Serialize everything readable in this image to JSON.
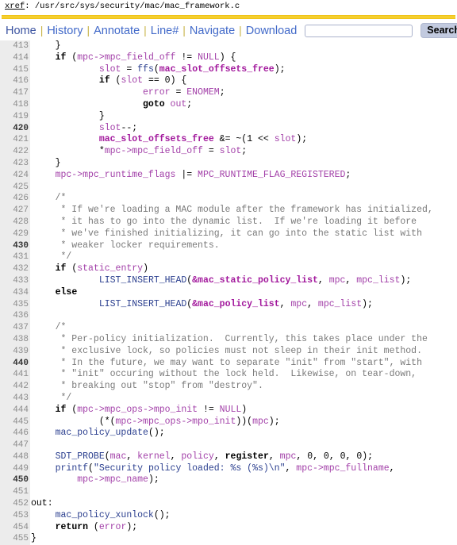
{
  "header": {
    "xref_label": "xref",
    "xref_colon": ": ",
    "file_path": "/usr/src/sys/security/mac/mac_framework.c"
  },
  "menubar": {
    "items": [
      {
        "label": "Home",
        "name": "nav-home"
      },
      {
        "label": "History",
        "name": "nav-history"
      },
      {
        "label": "Annotate",
        "name": "nav-annotate"
      },
      {
        "label": "Line#",
        "name": "nav-linenum"
      },
      {
        "label": "Navigate",
        "name": "nav-navigate"
      },
      {
        "label": "Download",
        "name": "nav-download"
      }
    ],
    "separator": "|",
    "search_value": "",
    "search_placeholder": "",
    "search_button_label": "Search",
    "checkbox_label": ""
  },
  "colors": {
    "rule_gold": "#f5cf2f",
    "link_blue": "#4169c9",
    "gutter_bg": "#ececec",
    "symbol_magenta": "#a23fa8",
    "function_navy": "#2b3f8f",
    "comment_gray": "#7a7a7a",
    "button_bg": "#c2cadf"
  },
  "code": {
    "first_line": 413,
    "lines": [
      {
        "n": "413",
        "segments": [
          {
            "t": "p",
            "x": "    }"
          }
        ]
      },
      {
        "n": "414",
        "segments": [
          {
            "t": "p",
            "x": "    "
          },
          {
            "t": "k",
            "x": "if"
          },
          {
            "t": "p",
            "x": " ("
          },
          {
            "t": "v",
            "x": "mpc->mpc_field_off"
          },
          {
            "t": "p",
            "x": " != "
          },
          {
            "t": "v",
            "x": "NULL"
          },
          {
            "t": "p",
            "x": ") {"
          }
        ]
      },
      {
        "n": "415",
        "segments": [
          {
            "t": "p",
            "x": "            "
          },
          {
            "t": "v",
            "x": "slot"
          },
          {
            "t": "p",
            "x": " = "
          },
          {
            "t": "f",
            "x": "ffs"
          },
          {
            "t": "p",
            "x": "("
          },
          {
            "t": "vb",
            "x": "mac_slot_offsets_free"
          },
          {
            "t": "p",
            "x": ");"
          }
        ]
      },
      {
        "n": "416",
        "segments": [
          {
            "t": "p",
            "x": "            "
          },
          {
            "t": "k",
            "x": "if"
          },
          {
            "t": "p",
            "x": " ("
          },
          {
            "t": "v",
            "x": "slot"
          },
          {
            "t": "p",
            "x": " == "
          },
          {
            "t": "n",
            "x": "0"
          },
          {
            "t": "p",
            "x": ") {"
          }
        ]
      },
      {
        "n": "417",
        "segments": [
          {
            "t": "p",
            "x": "                    "
          },
          {
            "t": "v",
            "x": "error"
          },
          {
            "t": "p",
            "x": " = "
          },
          {
            "t": "v",
            "x": "ENOMEM"
          },
          {
            "t": "p",
            "x": ";"
          }
        ]
      },
      {
        "n": "418",
        "segments": [
          {
            "t": "p",
            "x": "                    "
          },
          {
            "t": "k",
            "x": "goto"
          },
          {
            "t": "p",
            "x": " "
          },
          {
            "t": "v",
            "x": "out"
          },
          {
            "t": "p",
            "x": ";"
          }
        ]
      },
      {
        "n": "419",
        "segments": [
          {
            "t": "p",
            "x": "            }"
          }
        ]
      },
      {
        "n": "420",
        "segments": [
          {
            "t": "p",
            "x": "            "
          },
          {
            "t": "v",
            "x": "slot"
          },
          {
            "t": "p",
            "x": "--;"
          }
        ]
      },
      {
        "n": "421",
        "segments": [
          {
            "t": "p",
            "x": "            "
          },
          {
            "t": "vb",
            "x": "mac_slot_offsets_free"
          },
          {
            "t": "p",
            "x": " &= ~("
          },
          {
            "t": "n",
            "x": "1"
          },
          {
            "t": "p",
            "x": " << "
          },
          {
            "t": "v",
            "x": "slot"
          },
          {
            "t": "p",
            "x": ");"
          }
        ]
      },
      {
        "n": "422",
        "segments": [
          {
            "t": "p",
            "x": "            *"
          },
          {
            "t": "v",
            "x": "mpc->mpc_field_off"
          },
          {
            "t": "p",
            "x": " = "
          },
          {
            "t": "v",
            "x": "slot"
          },
          {
            "t": "p",
            "x": ";"
          }
        ]
      },
      {
        "n": "423",
        "segments": [
          {
            "t": "p",
            "x": "    }"
          }
        ]
      },
      {
        "n": "424",
        "segments": [
          {
            "t": "v",
            "x": "    mpc->mpc_runtime_flags"
          },
          {
            "t": "p",
            "x": " |= "
          },
          {
            "t": "v",
            "x": "MPC_RUNTIME_FLAG_REGISTERED"
          },
          {
            "t": "p",
            "x": ";"
          }
        ]
      },
      {
        "n": "425",
        "segments": [
          {
            "t": "p",
            "x": ""
          }
        ]
      },
      {
        "n": "426",
        "segments": [
          {
            "t": "c",
            "x": "    /*"
          }
        ]
      },
      {
        "n": "427",
        "segments": [
          {
            "t": "c",
            "x": "     * If we're loading a MAC module after the framework has initialized,"
          }
        ]
      },
      {
        "n": "428",
        "segments": [
          {
            "t": "c",
            "x": "     * it has to go into the dynamic list.  If we're loading it before"
          }
        ]
      },
      {
        "n": "429",
        "segments": [
          {
            "t": "c",
            "x": "     * we've finished initializing, it can go into the static list with"
          }
        ]
      },
      {
        "n": "430",
        "segments": [
          {
            "t": "c",
            "x": "     * weaker locker requirements."
          }
        ]
      },
      {
        "n": "431",
        "segments": [
          {
            "t": "c",
            "x": "     */"
          }
        ]
      },
      {
        "n": "432",
        "segments": [
          {
            "t": "p",
            "x": "    "
          },
          {
            "t": "k",
            "x": "if"
          },
          {
            "t": "p",
            "x": " ("
          },
          {
            "t": "v",
            "x": "static_entry"
          },
          {
            "t": "p",
            "x": ")"
          }
        ]
      },
      {
        "n": "433",
        "segments": [
          {
            "t": "p",
            "x": "            "
          },
          {
            "t": "f",
            "x": "LIST_INSERT_HEAD"
          },
          {
            "t": "p",
            "x": "("
          },
          {
            "t": "vb",
            "x": "&mac_static_policy_list"
          },
          {
            "t": "p",
            "x": ", "
          },
          {
            "t": "v",
            "x": "mpc"
          },
          {
            "t": "p",
            "x": ", "
          },
          {
            "t": "v",
            "x": "mpc_list"
          },
          {
            "t": "p",
            "x": ");"
          }
        ]
      },
      {
        "n": "434",
        "segments": [
          {
            "t": "p",
            "x": "    "
          },
          {
            "t": "k",
            "x": "else"
          }
        ]
      },
      {
        "n": "435",
        "segments": [
          {
            "t": "p",
            "x": "            "
          },
          {
            "t": "f",
            "x": "LIST_INSERT_HEAD"
          },
          {
            "t": "p",
            "x": "("
          },
          {
            "t": "vb",
            "x": "&mac_policy_list"
          },
          {
            "t": "p",
            "x": ", "
          },
          {
            "t": "v",
            "x": "mpc"
          },
          {
            "t": "p",
            "x": ", "
          },
          {
            "t": "v",
            "x": "mpc_list"
          },
          {
            "t": "p",
            "x": ");"
          }
        ]
      },
      {
        "n": "436",
        "segments": [
          {
            "t": "p",
            "x": ""
          }
        ]
      },
      {
        "n": "437",
        "segments": [
          {
            "t": "c",
            "x": "    /*"
          }
        ]
      },
      {
        "n": "438",
        "segments": [
          {
            "t": "c",
            "x": "     * Per-policy initialization.  Currently, this takes place under the"
          }
        ]
      },
      {
        "n": "439",
        "segments": [
          {
            "t": "c",
            "x": "     * exclusive lock, so policies must not sleep in their init method."
          }
        ]
      },
      {
        "n": "440",
        "segments": [
          {
            "t": "c",
            "x": "     * In the future, we may want to separate \"init\" from \"start\", with"
          }
        ]
      },
      {
        "n": "441",
        "segments": [
          {
            "t": "c",
            "x": "     * \"init\" occuring without the lock held.  Likewise, on tear-down,"
          }
        ]
      },
      {
        "n": "442",
        "segments": [
          {
            "t": "c",
            "x": "     * breaking out \"stop\" from \"destroy\"."
          }
        ]
      },
      {
        "n": "443",
        "segments": [
          {
            "t": "c",
            "x": "     */"
          }
        ]
      },
      {
        "n": "444",
        "segments": [
          {
            "t": "p",
            "x": "    "
          },
          {
            "t": "k",
            "x": "if"
          },
          {
            "t": "p",
            "x": " ("
          },
          {
            "t": "v",
            "x": "mpc->mpc_ops->mpo_init"
          },
          {
            "t": "p",
            "x": " != "
          },
          {
            "t": "v",
            "x": "NULL"
          },
          {
            "t": "p",
            "x": ")"
          }
        ]
      },
      {
        "n": "445",
        "segments": [
          {
            "t": "p",
            "x": "            (*("
          },
          {
            "t": "v",
            "x": "mpc->mpc_ops->mpo_init"
          },
          {
            "t": "p",
            "x": "))("
          },
          {
            "t": "v",
            "x": "mpc"
          },
          {
            "t": "p",
            "x": ");"
          }
        ]
      },
      {
        "n": "446",
        "segments": [
          {
            "t": "p",
            "x": "    "
          },
          {
            "t": "f",
            "x": "mac_policy_update"
          },
          {
            "t": "p",
            "x": "();"
          }
        ]
      },
      {
        "n": "447",
        "segments": [
          {
            "t": "p",
            "x": ""
          }
        ]
      },
      {
        "n": "448",
        "segments": [
          {
            "t": "p",
            "x": "    "
          },
          {
            "t": "f",
            "x": "SDT_PROBE"
          },
          {
            "t": "p",
            "x": "("
          },
          {
            "t": "v",
            "x": "mac"
          },
          {
            "t": "p",
            "x": ", "
          },
          {
            "t": "v",
            "x": "kernel"
          },
          {
            "t": "p",
            "x": ", "
          },
          {
            "t": "v",
            "x": "policy"
          },
          {
            "t": "p",
            "x": ", "
          },
          {
            "t": "k",
            "x": "register"
          },
          {
            "t": "p",
            "x": ", "
          },
          {
            "t": "v",
            "x": "mpc"
          },
          {
            "t": "p",
            "x": ", "
          },
          {
            "t": "n",
            "x": "0"
          },
          {
            "t": "p",
            "x": ", "
          },
          {
            "t": "n",
            "x": "0"
          },
          {
            "t": "p",
            "x": ", "
          },
          {
            "t": "n",
            "x": "0"
          },
          {
            "t": "p",
            "x": ", "
          },
          {
            "t": "n",
            "x": "0"
          },
          {
            "t": "p",
            "x": ");"
          }
        ]
      },
      {
        "n": "449",
        "segments": [
          {
            "t": "p",
            "x": "    "
          },
          {
            "t": "f",
            "x": "printf"
          },
          {
            "t": "p",
            "x": "("
          },
          {
            "t": "s",
            "x": "\"Security policy loaded: %s (%s)\\n\""
          },
          {
            "t": "p",
            "x": ", "
          },
          {
            "t": "v",
            "x": "mpc->mpc_fullname"
          },
          {
            "t": "p",
            "x": ","
          }
        ]
      },
      {
        "n": "450",
        "segments": [
          {
            "t": "p",
            "x": "        "
          },
          {
            "t": "v",
            "x": "mpc->mpc_name"
          },
          {
            "t": "p",
            "x": ");"
          }
        ]
      },
      {
        "n": "451",
        "segments": [
          {
            "t": "p",
            "x": ""
          }
        ]
      },
      {
        "n": "452",
        "segments": [
          {
            "t": "p",
            "x": "out:"
          }
        ],
        "nopad": true
      },
      {
        "n": "453",
        "segments": [
          {
            "t": "p",
            "x": "    "
          },
          {
            "t": "f",
            "x": "mac_policy_xunlock"
          },
          {
            "t": "p",
            "x": "();"
          }
        ]
      },
      {
        "n": "454",
        "segments": [
          {
            "t": "p",
            "x": "    "
          },
          {
            "t": "k",
            "x": "return"
          },
          {
            "t": "p",
            "x": " ("
          },
          {
            "t": "v",
            "x": "error"
          },
          {
            "t": "p",
            "x": ");"
          }
        ]
      },
      {
        "n": "455",
        "segments": [
          {
            "t": "p",
            "x": "}"
          }
        ],
        "nopad": true
      }
    ]
  }
}
